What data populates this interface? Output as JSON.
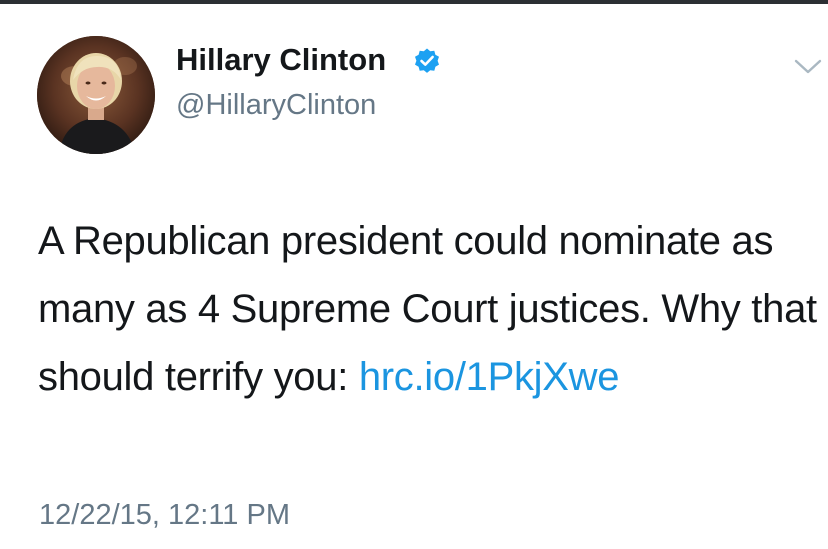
{
  "tweet": {
    "author_name": "Hillary Clinton",
    "author_handle": "@HillaryClinton",
    "text_before_link": "A Republican president could nominate as many as 4 Supreme Court justices. Why that should terrify you: ",
    "link_text": "hrc.io/1PkjXwe",
    "timestamp": "12/22/15, 12:11 PM"
  },
  "icons": {
    "verified": "verified-badge-icon",
    "menu": "chevron-down-icon"
  },
  "colors": {
    "text": "#14171a",
    "secondary": "#657786",
    "link": "#1b95e0",
    "verified": "#1da1f2"
  }
}
